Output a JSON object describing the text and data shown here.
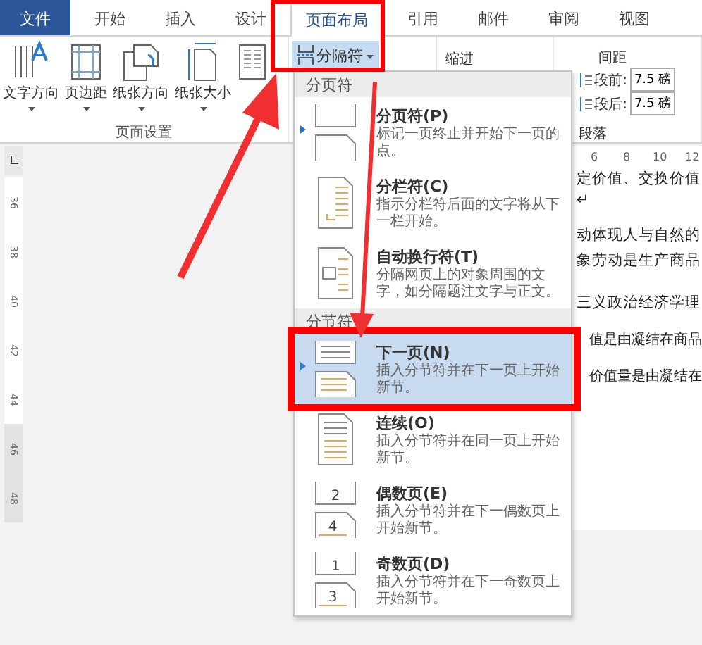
{
  "tabs": [
    {
      "label": "文件",
      "kind": "file",
      "selected": false
    },
    {
      "label": "开始",
      "kind": "tab",
      "selected": false
    },
    {
      "label": "插入",
      "kind": "tab",
      "selected": false
    },
    {
      "label": "设计",
      "kind": "tab",
      "selected": false
    },
    {
      "label": "页面布局",
      "kind": "tab",
      "selected": true
    },
    {
      "label": "引用",
      "kind": "tab",
      "selected": false
    },
    {
      "label": "邮件",
      "kind": "tab",
      "selected": false
    },
    {
      "label": "审阅",
      "kind": "tab",
      "selected": false
    },
    {
      "label": "视图",
      "kind": "tab",
      "selected": false
    }
  ],
  "ribbon": {
    "page_setup_buttons": [
      {
        "label": "文字方向",
        "kind": "text-direction"
      },
      {
        "label": "页边距",
        "kind": "margins"
      },
      {
        "label": "纸张方向",
        "kind": "orientation"
      },
      {
        "label": "纸张大小",
        "kind": "size"
      },
      {
        "kind": "columns"
      }
    ],
    "page_setup_label": "页面设置",
    "breaks_button": {
      "label": "分隔符",
      "expanded": true
    },
    "indent_label": "缩进",
    "spacing_label": "间距",
    "spacing": [
      {
        "label": "段前:",
        "value": "7.5 磅"
      },
      {
        "label": "段后:",
        "value": "7.5 磅"
      }
    ],
    "paragraph_label": "段落"
  },
  "vertical_ruler": [
    "36",
    "38",
    "40",
    "42",
    "44",
    "46",
    "48"
  ],
  "horizontal_ruler": [
    "6",
    "8",
    "10",
    "12"
  ],
  "document_lines": [
    "定价值、交换价值",
    "↵",
    "动体现人与自然的",
    "象劳动是生产商品",
    "三义政治经济学理",
    "值是由凝结在商品",
    "价值量是由凝结在"
  ],
  "menu": {
    "sections": [
      {
        "title": "分页符",
        "items": [
          {
            "title": "分页符(P)",
            "description": "标记一页终止并开始下一页的点。",
            "kind": "page-break",
            "default": true,
            "selected": false
          },
          {
            "title": "分栏符(C)",
            "description": "指示分栏符后面的文字将从下一栏开始。",
            "kind": "column-break",
            "default": false,
            "selected": false
          },
          {
            "title": "自动换行符(T)",
            "description": "分隔网页上的对象周围的文字，如分隔题注文字与正文。",
            "kind": "text-wrap",
            "default": false,
            "selected": false
          }
        ]
      },
      {
        "title": "分节符",
        "items": [
          {
            "title": "下一页(N)",
            "description": "插入分节符并在下一页上开始新节。",
            "kind": "next-page",
            "default": true,
            "selected": true
          },
          {
            "title": "连续(O)",
            "description": "插入分节符并在同一页上开始新节。",
            "kind": "continuous",
            "default": false,
            "selected": false
          },
          {
            "title": "偶数页(E)",
            "description": "插入分节符并在下一偶数页上开始新节。",
            "kind": "numbered",
            "numbers": [
              "2",
              "4"
            ],
            "default": false,
            "selected": false
          },
          {
            "title": "奇数页(D)",
            "description": "插入分节符并在下一奇数页上开始新节。",
            "kind": "numbered",
            "numbers": [
              "1",
              "3"
            ],
            "default": false,
            "selected": false
          }
        ]
      }
    ]
  }
}
